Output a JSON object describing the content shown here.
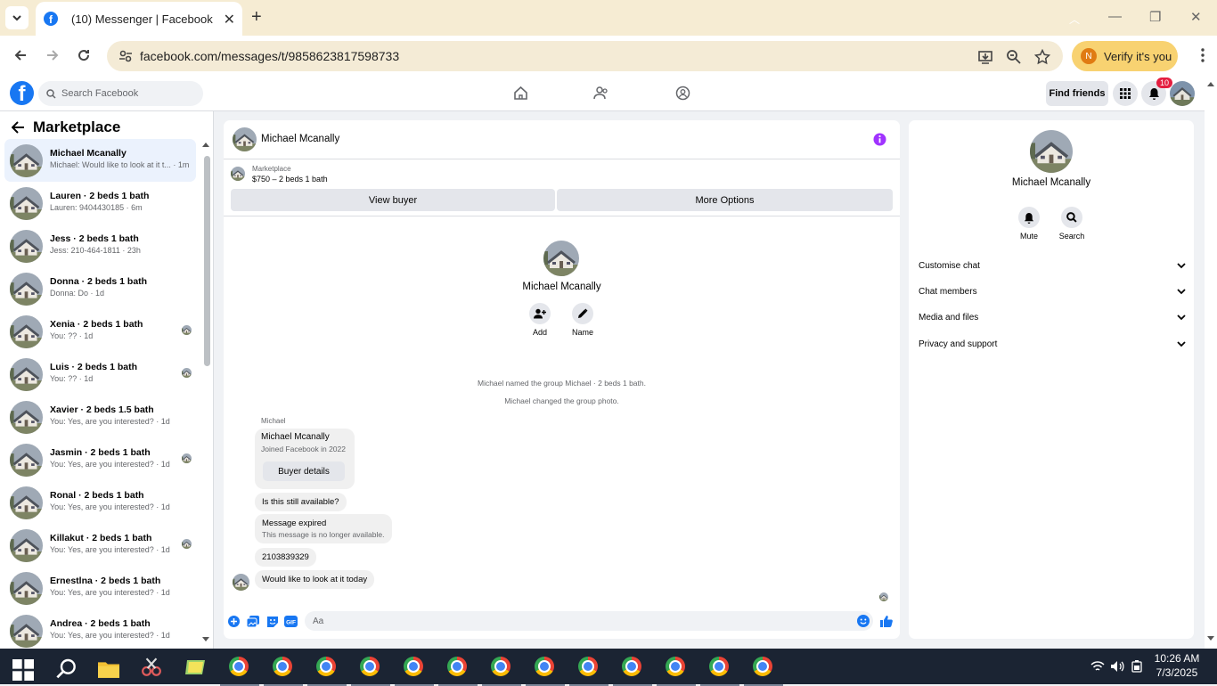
{
  "browser": {
    "tab_title": "(10) Messenger | Facebook",
    "url": "facebook.com/messages/t/9858623817598733",
    "verify_label": "Verify it's you",
    "verify_initial": "N"
  },
  "header": {
    "search_placeholder": "Search Facebook",
    "find_friends": "Find friends",
    "notifications_count": "10"
  },
  "left": {
    "title": "Marketplace",
    "conversations": [
      {
        "name": "Michael Mcanally",
        "preview": "Michael: Would like to look at it t... · 1m",
        "active": true
      },
      {
        "name": "Lauren · 2 beds 1 bath",
        "preview": "Lauren: 9404430185 · 6m"
      },
      {
        "name": "Jess · 2 beds 1 bath",
        "preview": "Jess: 210-464-1811 · 23h"
      },
      {
        "name": "Donna · 2 beds 1 bath",
        "preview": "Donna: Do · 1d"
      },
      {
        "name": "Xenia · 2 beds 1 bath",
        "preview": "You: ?? · 1d",
        "seen": true
      },
      {
        "name": "Luis · 2 beds 1 bath",
        "preview": "You: ?? · 1d",
        "seen": true
      },
      {
        "name": "Xavier · 2 beds 1.5 bath",
        "preview": "You: Yes, are you interested? · 1d"
      },
      {
        "name": "Jasmin · 2 beds 1 bath",
        "preview": "You: Yes, are you interested? · 1d",
        "seen": true
      },
      {
        "name": "Ronal · 2 beds 1 bath",
        "preview": "You: Yes, are you interested? · 1d"
      },
      {
        "name": "Killakut · 2 beds 1 bath",
        "preview": "You: Yes, are you interested? · 1d",
        "seen": true
      },
      {
        "name": "Ernestlna · 2 beds 1 bath",
        "preview": "You: Yes, are you interested? · 1d"
      },
      {
        "name": "Andrea · 2 beds 1 bath",
        "preview": "You: Yes, are you interested? · 1d"
      }
    ]
  },
  "chat": {
    "name": "Michael Mcanally",
    "marketplace_label": "Marketplace",
    "listing": "$750 – 2 beds 1 bath",
    "view_buyer": "View buyer",
    "more_options": "More Options",
    "profile_name": "Michael Mcanally",
    "add_label": "Add",
    "name_label": "Name",
    "system1": "Michael named the group Michael · 2 beds 1 bath.",
    "system2": "Michael changed the group photo.",
    "sender": "Michael",
    "card_name": "Michael Mcanally",
    "card_joined": "Joined Facebook in 2022",
    "buyer_details": "Buyer details",
    "msg1": "Is this still available?",
    "expired_title": "Message expired",
    "expired_sub": "This message is no longer available.",
    "msg2": "2103839329",
    "msg3": "Would like to look at it today",
    "composer_placeholder": "Aa"
  },
  "right": {
    "name": "Michael Mcanally",
    "mute": "Mute",
    "search": "Search",
    "rows": [
      "Customise chat",
      "Chat members",
      "Media and files",
      "Privacy and support"
    ]
  },
  "taskbar": {
    "time": "10:26 AM",
    "date": "7/3/2025"
  },
  "colors": {
    "fb_blue": "#1877f2",
    "accent_purple": "#a033ff",
    "tab_bg": "#f6ecd3"
  }
}
